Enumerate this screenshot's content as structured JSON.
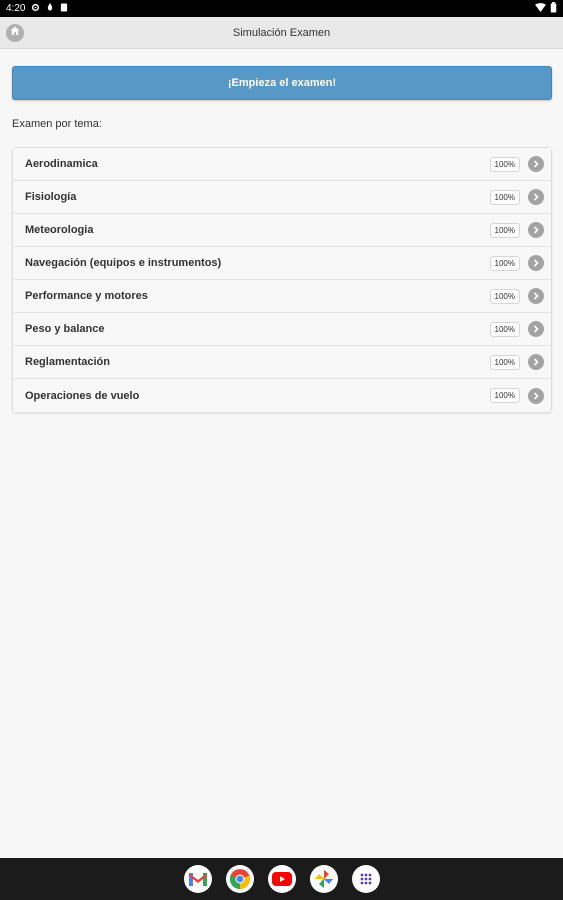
{
  "status_bar": {
    "time": "4:20",
    "icons": [
      "settings-icon",
      "notification-icon",
      "storage-icon",
      "wifi-icon",
      "battery-icon"
    ]
  },
  "header": {
    "title": "Simulación Examen",
    "home_icon": "home-icon"
  },
  "start_button": {
    "label": "¡Empieza el examen!"
  },
  "section": {
    "label": "Examen por tema:"
  },
  "topics": [
    {
      "label": "Aerodinamica",
      "score": "100%"
    },
    {
      "label": "Fisiología",
      "score": "100%"
    },
    {
      "label": "Meteorologia",
      "score": "100%"
    },
    {
      "label": "Navegación (equipos e instrumentos)",
      "score": "100%"
    },
    {
      "label": "Performance y motores",
      "score": "100%"
    },
    {
      "label": "Peso y balance",
      "score": "100%"
    },
    {
      "label": "Reglamentación",
      "score": "100%"
    },
    {
      "label": "Operaciones de vuelo",
      "score": "100%"
    }
  ],
  "dock": {
    "apps": [
      "gmail-icon",
      "chrome-icon",
      "youtube-icon",
      "photos-icon",
      "app-drawer-icon"
    ]
  },
  "colors": {
    "accent": "#5898c6",
    "header_bg": "#e9e9e9",
    "page_bg": "#f7f7f7"
  }
}
